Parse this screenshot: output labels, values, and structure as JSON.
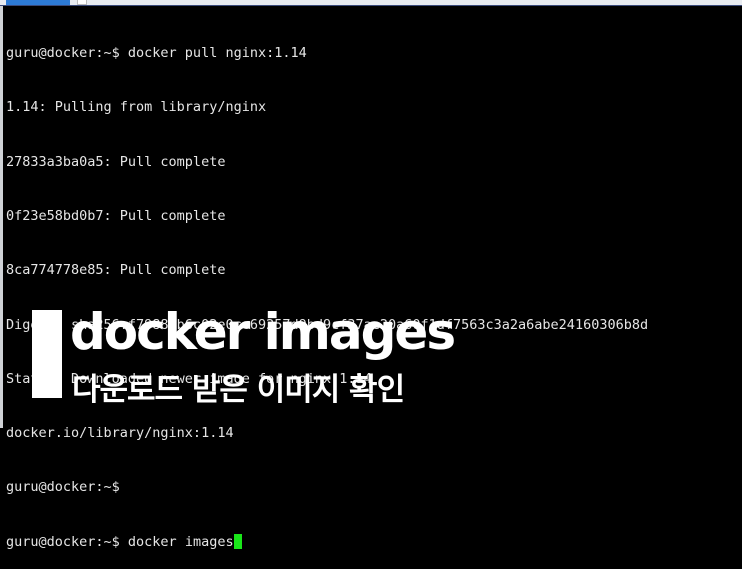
{
  "terminal": {
    "lines": [
      "guru@docker:~$ docker pull nginx:1.14",
      "1.14: Pulling from library/nginx",
      "27833a3ba0a5: Pull complete",
      "0f23e58bd0b7: Pull complete",
      "8ca774778e85: Pull complete",
      "Digest: sha256:f7988fb6c02e0ce69257d9bd9cf37ae20a60f1df7563c3a2a6abe24160306b8d",
      "Status: Downloaded newer image for nginx:1.14",
      "docker.io/library/nginx:1.14",
      "guru@docker:~$"
    ],
    "current_prompt": "guru@docker:~$ ",
    "current_input": "docker images",
    "cursor_color": "#19e619"
  },
  "caption": {
    "title": "docker images",
    "subtitle": "다운로드 받은 이미지 확인"
  }
}
